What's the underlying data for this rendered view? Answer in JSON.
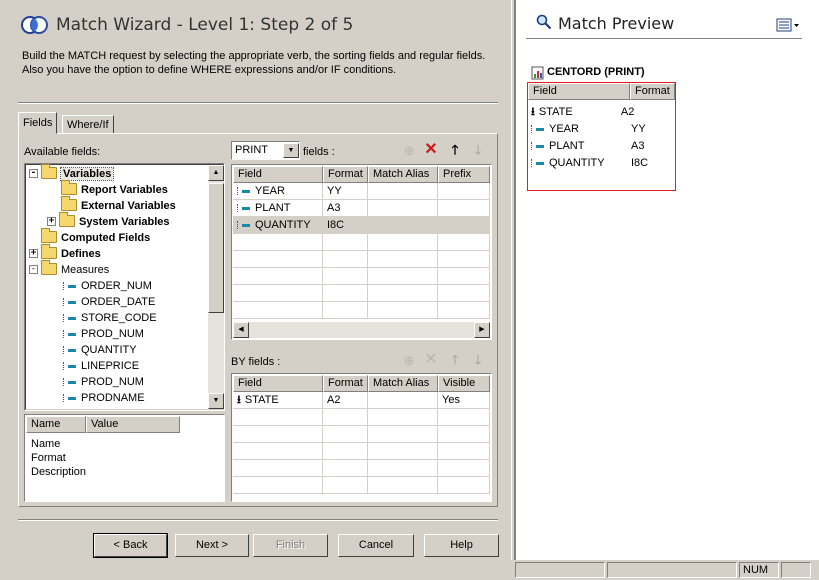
{
  "wizard": {
    "title": "Match Wizard - Level 1: Step 2 of 5",
    "description": "Build the MATCH request by selecting the appropriate verb, the sorting fields and regular fields. Also you have the option to  define WHERE expressions and/or  IF conditions.",
    "tabs": [
      {
        "label": "Fields",
        "active": true
      },
      {
        "label": "Where/If",
        "active": false
      }
    ]
  },
  "available_fields": {
    "label": "Available fields:",
    "tree": [
      {
        "label": "Variables",
        "bold": true,
        "toggle": "−",
        "icon": "folder-icon"
      },
      {
        "label": "Report Variables",
        "bold": true,
        "toggle": "",
        "icon": "folder-icon"
      },
      {
        "label": "External Variables",
        "bold": true,
        "toggle": "",
        "icon": "folder-icon"
      },
      {
        "label": "System Variables",
        "bold": true,
        "toggle": "+",
        "icon": "folder-icon"
      },
      {
        "label": "Computed Fields",
        "bold": true,
        "toggle": "",
        "icon": "folder-icon"
      },
      {
        "label": "Defines",
        "bold": true,
        "toggle": "+",
        "icon": "folder-icon"
      },
      {
        "label": "Measures",
        "bold": false,
        "toggle": "−",
        "icon": "folder-icon"
      },
      {
        "label": "ORDER_NUM",
        "bold": false,
        "icon": "field-icon"
      },
      {
        "label": "ORDER_DATE",
        "bold": false,
        "icon": "field-icon"
      },
      {
        "label": "STORE_CODE",
        "bold": false,
        "icon": "field-icon"
      },
      {
        "label": "PROD_NUM",
        "bold": false,
        "icon": "field-icon"
      },
      {
        "label": "QUANTITY",
        "bold": false,
        "icon": "field-icon"
      },
      {
        "label": "LINEPRICE",
        "bold": false,
        "icon": "field-icon"
      },
      {
        "label": "PROD_NUM",
        "bold": false,
        "icon": "field-icon"
      },
      {
        "label": "PRODNAME",
        "bold": false,
        "icon": "field-icon"
      }
    ]
  },
  "properties": {
    "headers": [
      "Name",
      "Value"
    ],
    "rows": [
      "Name",
      "Format",
      "Description"
    ]
  },
  "verb_select": {
    "value": "PRINT",
    "suffix": "fields :"
  },
  "fields_grid": {
    "headers": [
      "Field",
      "Format",
      "Match Alias",
      "Prefix"
    ],
    "rows": [
      {
        "field": "YEAR",
        "format": "YY",
        "selected": false
      },
      {
        "field": "PLANT",
        "format": "A3",
        "selected": false
      },
      {
        "field": "QUANTITY",
        "format": "I8C",
        "selected": true
      }
    ]
  },
  "by_fields": {
    "label": "BY fields :",
    "headers": [
      "Field",
      "Format",
      "Match Alias",
      "Visible"
    ],
    "rows": [
      {
        "field": "STATE",
        "format": "A2",
        "visible": "Yes"
      }
    ]
  },
  "buttons": {
    "back": "< Back",
    "next": "Next >",
    "finish": "Finish",
    "cancel": "Cancel",
    "help": "Help"
  },
  "preview": {
    "title": "Match Preview",
    "node_label": "CENTORD (PRINT)",
    "headers": [
      "Field",
      "Format"
    ],
    "rows": [
      {
        "field": "STATE",
        "format": "A2",
        "icon": "sort-down-icon"
      },
      {
        "field": "YEAR",
        "format": "YY",
        "icon": "field-icon"
      },
      {
        "field": "PLANT",
        "format": "A3",
        "icon": "field-icon"
      },
      {
        "field": "QUANTITY",
        "format": "I8C",
        "icon": "field-icon"
      }
    ],
    "highlight_color": "#e0201f"
  },
  "statusbar": {
    "num": "NUM"
  }
}
